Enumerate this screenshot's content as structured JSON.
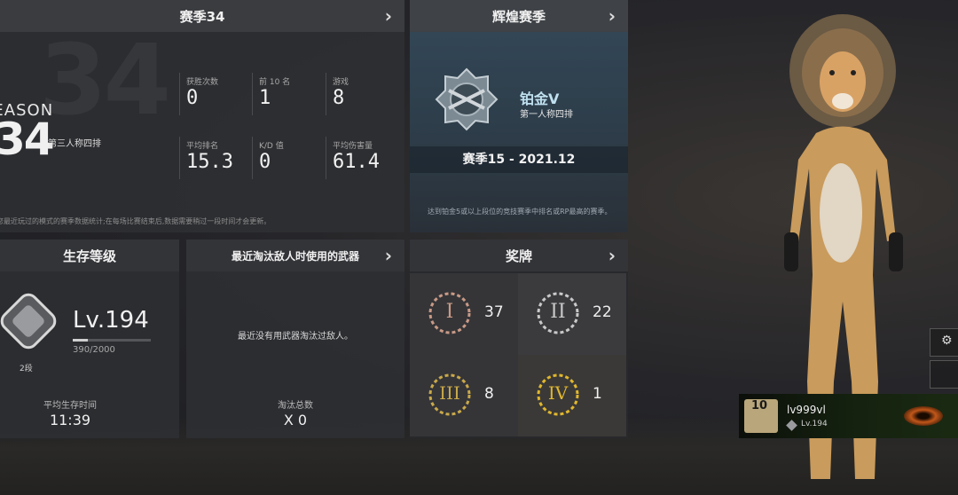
{
  "season_panel": {
    "title": "赛季34",
    "big_number": "34",
    "season_word": "SEASON",
    "season_num": "34",
    "mode": "第三人称四排",
    "stats": [
      {
        "label": "获胜次数",
        "value": "0"
      },
      {
        "label": "前 10 名",
        "value": "1"
      },
      {
        "label": "游戏",
        "value": "8"
      },
      {
        "label": "平均排名",
        "value": "15.3"
      },
      {
        "label": "K/D 值",
        "value": "0"
      },
      {
        "label": "平均伤害量",
        "value": "61.4"
      }
    ],
    "footnote": "您最近玩过的模式的赛季数据统计;在每场比赛结束后,数据需要稍过一段时间才会更新。"
  },
  "glory_panel": {
    "title": "辉煌赛季",
    "rank_name": "铂金V",
    "mode": "第一人称四排",
    "season_label": "赛季15 - 2021.12",
    "footnote": "达到铂金5或以上段位的竞技赛季中排名或RP最高的赛季。"
  },
  "survival_panel": {
    "title": "生存等级",
    "level": "Lv.194",
    "xp": "390/2000",
    "xp_fraction": 0.195,
    "tier": "2段",
    "avg_survival_label": "平均生存时间",
    "avg_survival_value": "11:39"
  },
  "weapon_panel": {
    "title": "最近淘汰敌人时使用的武器",
    "empty_text": "最近没有用武器淘汰过敌人。",
    "kills_label": "淘汰总数",
    "kills_value": "X 0"
  },
  "medals_panel": {
    "title": "奖牌",
    "medals": [
      {
        "numeral": "I",
        "count": "37",
        "color": "#c89a86"
      },
      {
        "numeral": "II",
        "count": "22",
        "color": "#c9c9c9"
      },
      {
        "numeral": "III",
        "count": "8",
        "color": "#c9a94a"
      },
      {
        "numeral": "IV",
        "count": "1",
        "color": "#e0b72e"
      }
    ]
  },
  "player_card": {
    "badge_level": "10",
    "name": "lv999vl",
    "level": "Lv.194"
  },
  "side_buttons": {
    "top_icon": "gear-icon"
  }
}
